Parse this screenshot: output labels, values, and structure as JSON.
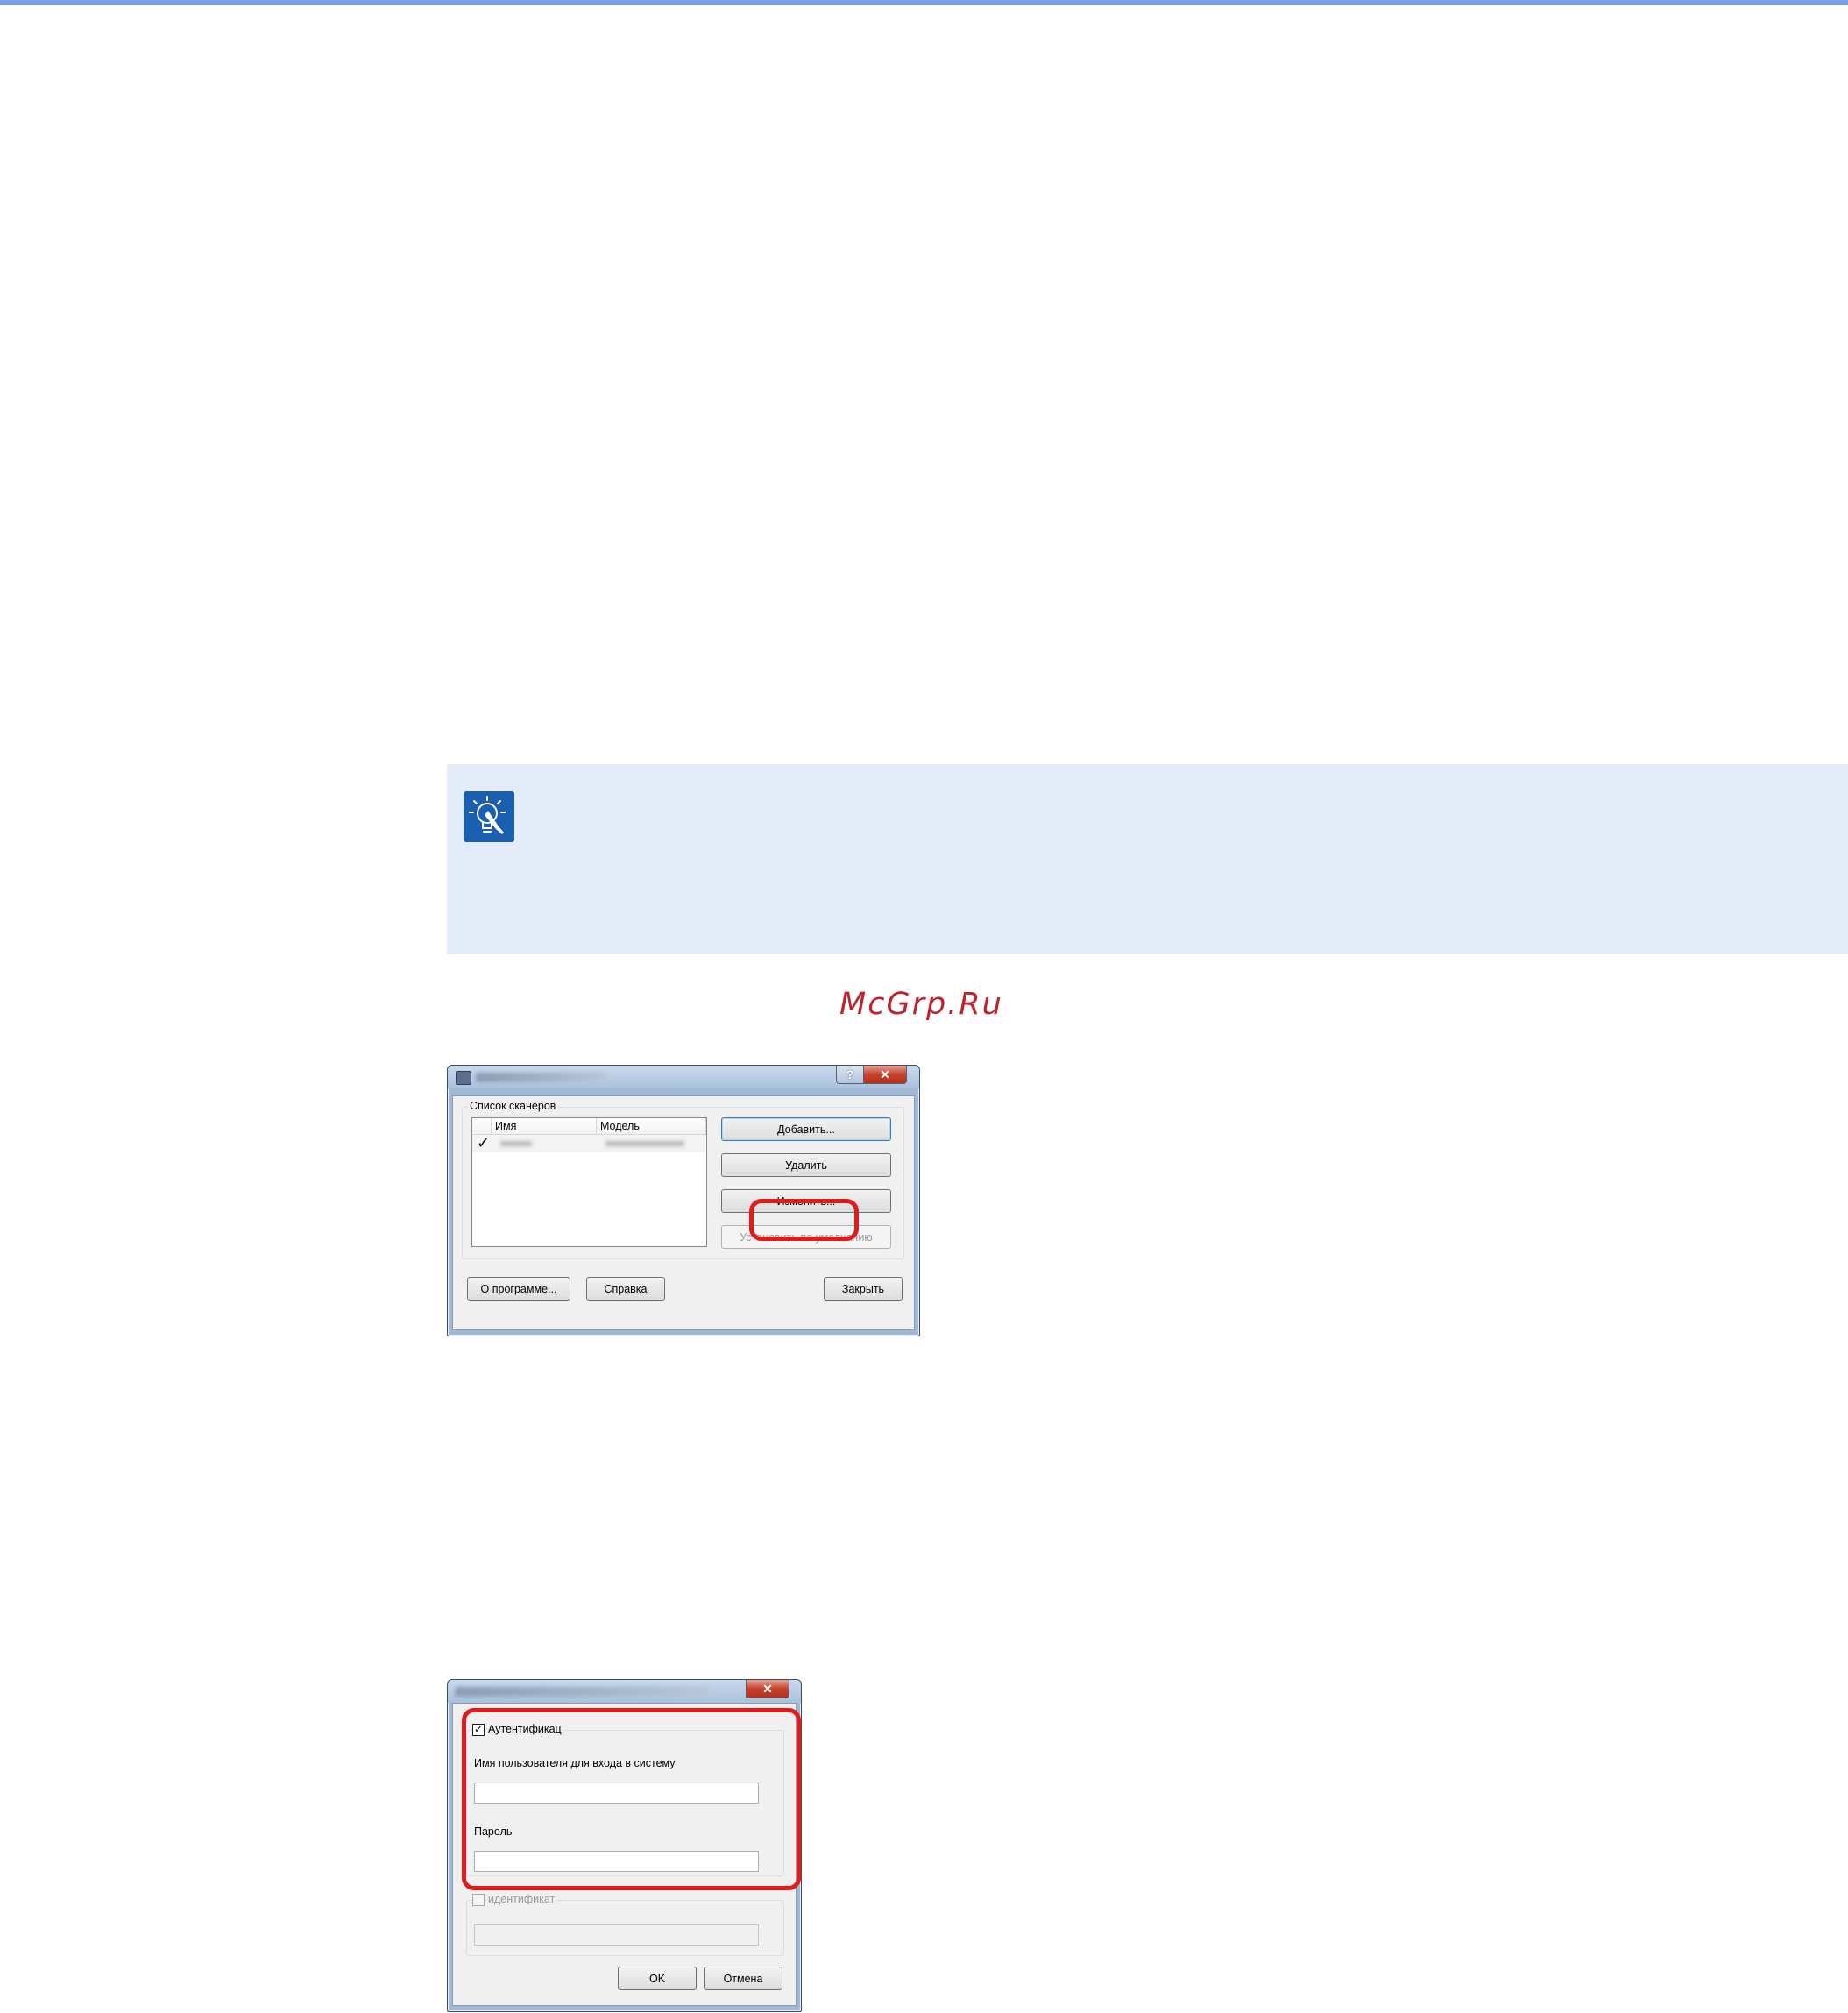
{
  "note": {
    "icon": "lightbulb-note-icon"
  },
  "watermark": "McGrp.Ru",
  "scanner_dialog": {
    "group_label": "Список сканеров",
    "columns": [
      "Имя",
      "Модель"
    ],
    "buttons": {
      "add": "Добавить...",
      "delete": "Удалить",
      "edit": "Изменить...",
      "set_default": "Установить по умолчанию",
      "about": "О программе...",
      "help": "Справка",
      "close": "Закрыть"
    },
    "help_glyph": "?",
    "close_glyph": "✕",
    "check_glyph": "✓"
  },
  "auth_dialog": {
    "auth_checkbox_label": "Аутентификац",
    "username_label": "Имя пользователя для входа в систему",
    "password_label": "Пароль",
    "id_checkbox_label": "идентификат",
    "ok": "OK",
    "cancel": "Отмена",
    "close_glyph": "✕",
    "check_glyph": "✓"
  },
  "colors": {
    "highlight": "#e01b1b",
    "note_bg": "#e5ecf9",
    "note_icon": "#1a5fb0",
    "top_rule": "#7fa0e3"
  }
}
